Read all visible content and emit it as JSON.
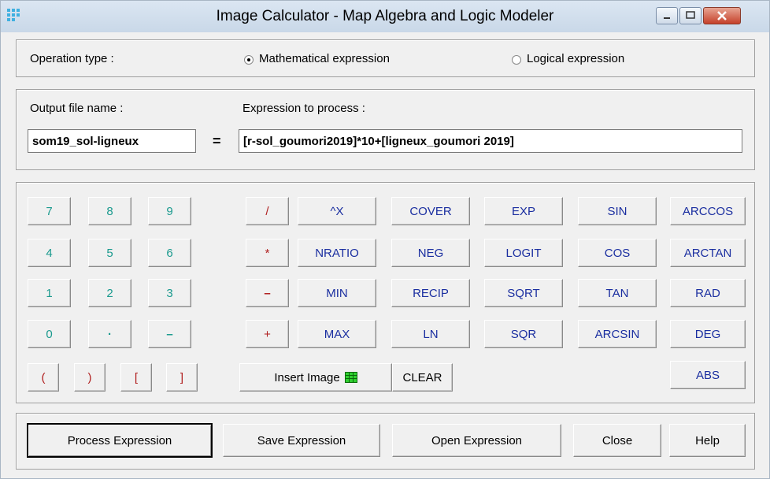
{
  "window": {
    "title": "Image Calculator - Map  Algebra and Logic Modeler"
  },
  "operation": {
    "label": "Operation type :",
    "math_label": "Mathematical expression",
    "logic_label": "Logical expression",
    "selected": "Mathematical expression"
  },
  "output": {
    "label": "Output file name :",
    "value": "som19_sol-ligneux"
  },
  "equals": "=",
  "expression": {
    "label": "Expression to process :",
    "value": "[r-sol_goumori2019]*10+[ligneux_goumori 2019]"
  },
  "keypad": {
    "row1": [
      "7",
      "8",
      "9"
    ],
    "row2": [
      "4",
      "5",
      "6"
    ],
    "row3": [
      "1",
      "2",
      "3"
    ],
    "row4": [
      "0",
      "·",
      "–"
    ],
    "brackets": [
      "(",
      ")",
      "[",
      "]"
    ]
  },
  "operators": [
    "/",
    "*",
    "–",
    "+"
  ],
  "functions": {
    "col1": [
      "^X",
      "NRATIO",
      "MIN",
      "MAX"
    ],
    "col2": [
      "COVER",
      "NEG",
      "RECIP",
      "LN"
    ],
    "col3": [
      "EXP",
      "LOGIT",
      "SQRT",
      "SQR"
    ],
    "col4": [
      "SIN",
      "COS",
      "TAN",
      "ARCSIN"
    ],
    "col5": [
      "ARCCOS",
      "ARCTAN",
      "RAD",
      "DEG",
      "ABS"
    ]
  },
  "insert_image": "Insert Image",
  "clear": "CLEAR",
  "actions": {
    "process": "Process Expression",
    "save": "Save Expression",
    "open": "Open Expression",
    "close": "Close",
    "help": "Help"
  },
  "colors": {
    "number": "#1a9a8e",
    "operator": "#b01e1e",
    "function": "#1a2ea0"
  }
}
